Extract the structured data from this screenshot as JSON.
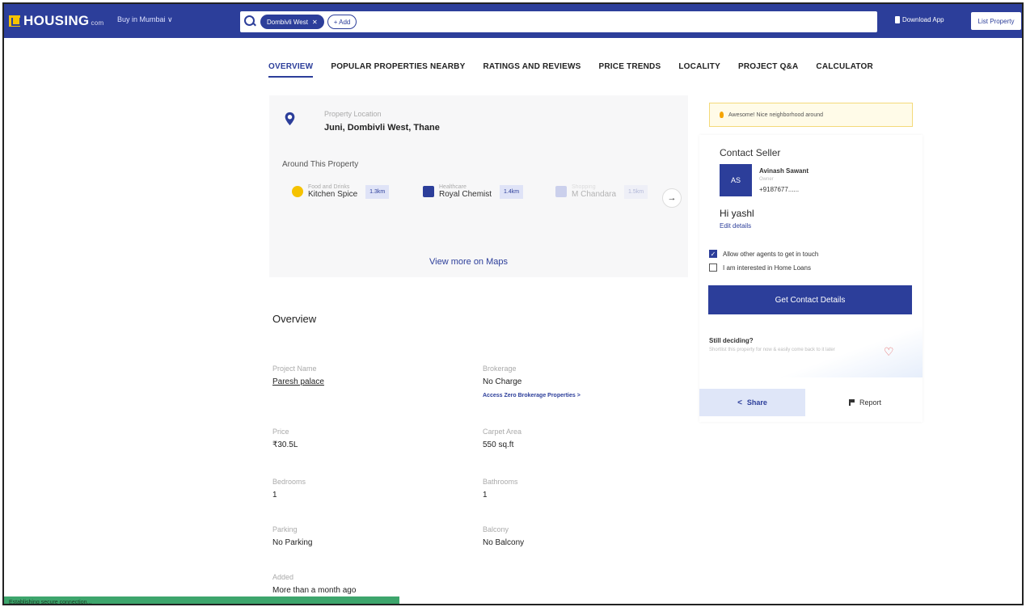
{
  "header": {
    "logo_text": "HOUSING",
    "logo_suffix": "com",
    "city_selector": "Buy in Mumbai ∨",
    "search_chip": "Dombivli West",
    "search_add": "+ Add",
    "download_app": "Download App",
    "list_property": "List Property"
  },
  "tabs": [
    {
      "label": "OVERVIEW"
    },
    {
      "label": "POPULAR PROPERTIES NEARBY"
    },
    {
      "label": "RATINGS AND REVIEWS"
    },
    {
      "label": "PRICE TRENDS"
    },
    {
      "label": "LOCALITY"
    },
    {
      "label": "PROJECT Q&A"
    },
    {
      "label": "CALCULATOR"
    }
  ],
  "location": {
    "label": "Property Location",
    "value": "Juni, Dombivli West, Thane",
    "around_title": "Around This Property",
    "amenities": [
      {
        "category": "Food and Drinks",
        "name": "Kitchen Spice",
        "distance": "1.3km"
      },
      {
        "category": "Healthcare",
        "name": "Royal Chemist",
        "distance": "1.4km"
      },
      {
        "category": "Shopping",
        "name": "M Chandara",
        "distance": "1.5km"
      }
    ],
    "view_maps": "View more on Maps"
  },
  "overview": {
    "title": "Overview",
    "fields": [
      {
        "label": "Project Name",
        "value": "Paresh palace"
      },
      {
        "label": "Brokerage",
        "value": "No Charge",
        "sub": "Access Zero Brokerage Properties >"
      },
      {
        "label": "Price",
        "value": "₹30.5L"
      },
      {
        "label": "Carpet Area",
        "value": "550 sq.ft"
      },
      {
        "label": "Bedrooms",
        "value": "1"
      },
      {
        "label": "Bathrooms",
        "value": "1"
      },
      {
        "label": "Parking",
        "value": "No Parking"
      },
      {
        "label": "Balcony",
        "value": "No Balcony"
      },
      {
        "label": "Added",
        "value": "More than a month ago"
      }
    ]
  },
  "contact": {
    "banner": "Awesome! Nice neighborhood around",
    "title": "Contact Seller",
    "avatar_initials": "AS",
    "seller_name": "Avinash Sawant",
    "seller_role": "Owner",
    "seller_phone": "+9187677......",
    "greeting": "Hi yashl",
    "edit_details": "Edit details",
    "checkbox_agents": "Allow other agents to get in touch",
    "checkbox_loans": "I am interested in Home Loans",
    "cta": "Get Contact Details",
    "still_deciding": "Still deciding?",
    "still_sub": "Shortlist this property for now & easily come back to it later",
    "share": "Share",
    "report": "Report"
  },
  "status_bar": "Establishing secure connection..."
}
